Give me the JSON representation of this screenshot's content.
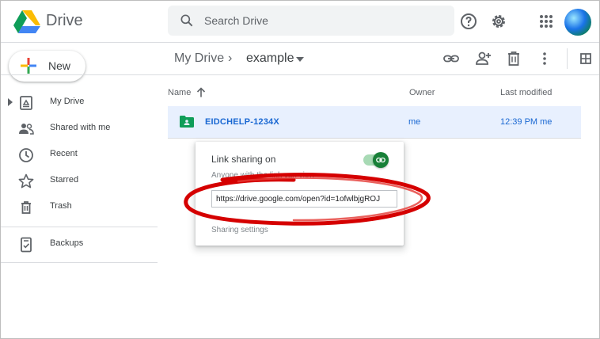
{
  "app": {
    "name": "Drive"
  },
  "search": {
    "placeholder": "Search Drive",
    "value": ""
  },
  "header": {
    "icons": [
      "help-icon",
      "settings-icon",
      "apps-icon",
      "account-avatar"
    ]
  },
  "sidebar": {
    "new_label": "New",
    "items": [
      {
        "label": "My Drive",
        "icon": "my-drive-icon"
      },
      {
        "label": "Shared with me",
        "icon": "shared-icon"
      },
      {
        "label": "Recent",
        "icon": "clock-icon"
      },
      {
        "label": "Starred",
        "icon": "star-icon"
      },
      {
        "label": "Trash",
        "icon": "trash-icon"
      },
      {
        "label": "Backups",
        "icon": "backup-icon"
      }
    ]
  },
  "breadcrumb": {
    "root": "My Drive",
    "separator": "›",
    "current": "example"
  },
  "toolbar": {
    "icons": [
      "get-link-icon",
      "share-icon",
      "delete-icon",
      "more-icon",
      "grid-view-icon"
    ]
  },
  "columns": {
    "name": "Name",
    "owner": "Owner",
    "last_modified": "Last modified"
  },
  "files": [
    {
      "name": "EIDCHELP-1234X",
      "owner": "me",
      "last_modified": "12:39 PM me"
    }
  ],
  "popup": {
    "title": "Link sharing on",
    "subtitle": "Anyone with the link can view",
    "link": "https://drive.google.com/open?id=1ofwlbjgROJ",
    "settings_label": "Sharing settings",
    "toggle_on": true
  },
  "colors": {
    "accent": "#1967d2",
    "selected_row": "#e8f0fe",
    "toggle": "#188038",
    "annotation": "#d50000"
  }
}
